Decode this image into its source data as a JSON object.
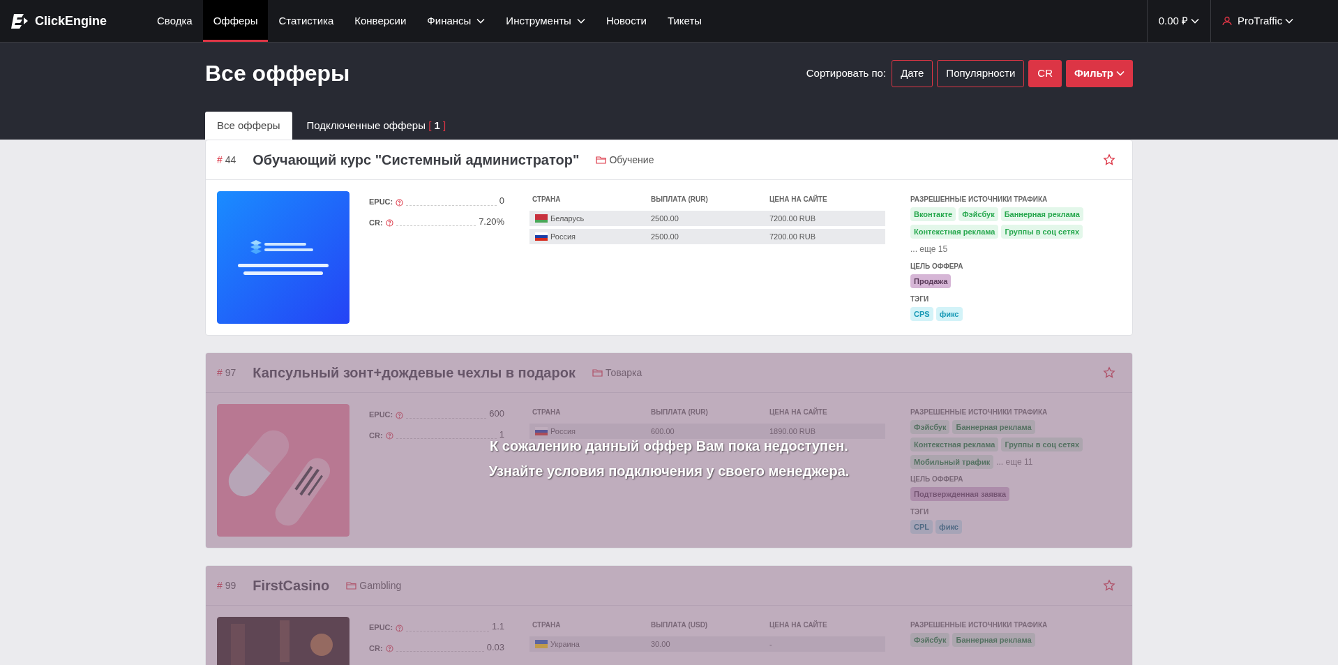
{
  "nav": {
    "logo": "ClickEngine",
    "items": [
      {
        "label": "Сводка",
        "selected": false,
        "dropdown": false
      },
      {
        "label": "Офферы",
        "selected": true,
        "dropdown": false
      },
      {
        "label": "Статистика",
        "selected": false,
        "dropdown": false
      },
      {
        "label": "Конверсии",
        "selected": false,
        "dropdown": false
      },
      {
        "label": "Финансы",
        "selected": false,
        "dropdown": true
      },
      {
        "label": "Инструменты",
        "selected": false,
        "dropdown": true
      },
      {
        "label": "Новости",
        "selected": false,
        "dropdown": false
      },
      {
        "label": "Тикеты",
        "selected": false,
        "dropdown": false
      }
    ],
    "balance": "0.00 ₽",
    "user": "ProTraffic"
  },
  "header": {
    "title": "Все офферы",
    "sort_label": "Сортировать по:",
    "sort_buttons": [
      {
        "label": "Дате",
        "kind": "outline"
      },
      {
        "label": "Популярности",
        "kind": "outline"
      },
      {
        "label": "CR",
        "kind": "filled"
      }
    ],
    "filter": "Фильтр"
  },
  "tabs": [
    {
      "label": "Все офферы",
      "selected": true
    },
    {
      "label": "Подключенные офферы",
      "open": "[",
      "count": "1",
      "close": "]",
      "selected": false
    }
  ],
  "offers": [
    {
      "hash": "#",
      "id": "44",
      "title": "Обучающий курс \"Системный администратор\"",
      "category": "Обучение",
      "favorite": false,
      "epuc_label": "EPUC:",
      "epuc": "0",
      "cr_label": "CR:",
      "cr": "7.20%",
      "columns": [
        "СТРАНА",
        "ВЫПЛАТА (RUR)",
        "ЦЕНА НА САЙТЕ"
      ],
      "rows": [
        {
          "country": "Беларусь",
          "payout": "2500.00",
          "price": "7200.00 RUB"
        },
        {
          "country": "Россия",
          "payout": "2500.00",
          "price": "7200.00 RUB"
        }
      ],
      "sources_label": "РАЗРЕШЕННЫЕ ИСТОЧНИКИ ТРАФИКА",
      "sources": [
        "Вконтакте",
        "Фэйсбук",
        "Баннерная реклама",
        "Контекстная реклама",
        "Группы в соц сетях"
      ],
      "more": "... еще 15",
      "goal_label": "ЦЕЛЬ ОФФЕРА",
      "goal": "Продажа",
      "tags_label": "ТЭГИ",
      "tags": [
        "CPS",
        "фикс"
      ],
      "locked": false
    },
    {
      "hash": "#",
      "id": "97",
      "title": "Капсульный зонт+дождевые чехлы в подарок",
      "category": "Товарка",
      "favorite": false,
      "epuc_label": "EPUC:",
      "epuc": "600",
      "cr_label": "CR:",
      "cr": "1",
      "columns": [
        "СТРАНА",
        "ВЫПЛАТА (RUR)",
        "ЦЕНА НА САЙТЕ"
      ],
      "rows": [
        {
          "country": "Россия",
          "payout": "600.00",
          "price": "1890.00 RUB"
        }
      ],
      "sources_label": "РАЗРЕШЕННЫЕ ИСТОЧНИКИ ТРАФИКА",
      "sources": [
        "Фэйсбук",
        "Баннерная реклама",
        "Контекстная реклама",
        "Группы в соц сетях",
        "Мобильный трафик"
      ],
      "more": "... еще 11",
      "goal_label": "ЦЕЛЬ ОФФЕРА",
      "goal": "Подтвержденная заявка",
      "tags_label": "ТЭГИ",
      "tags": [
        "CPL",
        "фикс"
      ],
      "locked": true,
      "message": [
        "К сожалению данный оффер Вам пока недоступен.",
        "Узнайте условия подключения у своего менеджера."
      ]
    },
    {
      "hash": "#",
      "id": "99",
      "title": "FirstCasino",
      "category": "Gambling",
      "favorite": false,
      "epuc_label": "EPUC:",
      "epuc": "1.1",
      "cr_label": "CR:",
      "cr": "0.03",
      "columns": [
        "СТРАНА",
        "ВЫПЛАТА (USD)",
        "ЦЕНА НА САЙТЕ"
      ],
      "rows": [
        {
          "country": "Украина",
          "payout": "30.00",
          "price": "-"
        }
      ],
      "sources_label": "РАЗРЕШЕННЫЕ ИСТОЧНИКИ ТРАФИКА",
      "sources": [
        "Фэйсбук",
        "Баннерная реклама"
      ],
      "locked": true
    }
  ]
}
